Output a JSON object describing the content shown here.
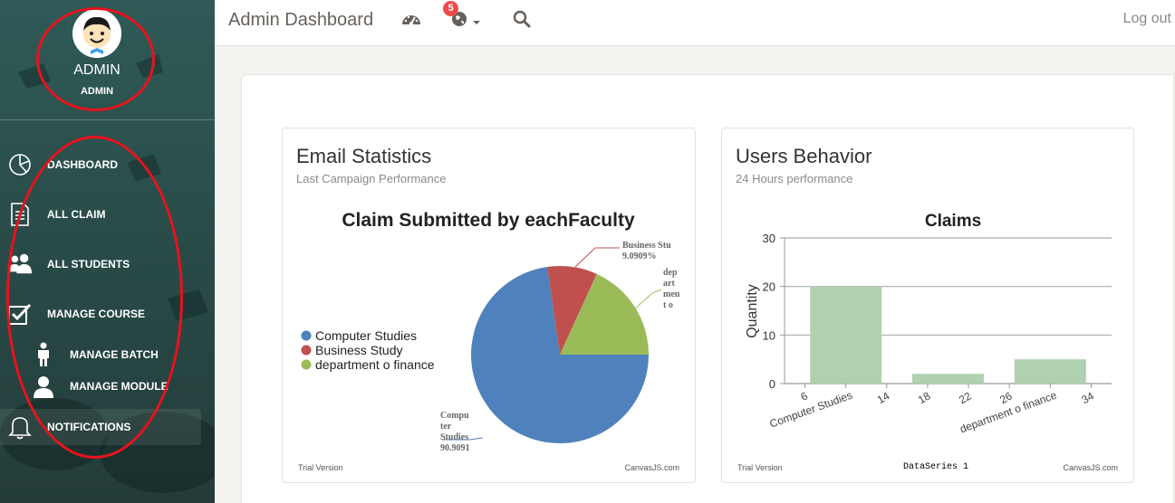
{
  "sidebar": {
    "admin_name": "ADMIN",
    "admin_role": "ADMIN",
    "items": [
      {
        "label": "DASHBOARD",
        "icon": "pie-chart-icon"
      },
      {
        "label": "ALL CLAIM",
        "icon": "document-icon"
      },
      {
        "label": "ALL STUDENTS",
        "icon": "users-icon"
      },
      {
        "label": "MANAGE COURSE",
        "icon": "checkbox-icon"
      },
      {
        "label": "MANAGE BATCH",
        "icon": "person-icon"
      },
      {
        "label": "MANAGE MODULE",
        "icon": "user-icon"
      },
      {
        "label": "NOTIFICATIONS",
        "icon": "bell-icon"
      }
    ]
  },
  "topbar": {
    "title": "Admin Dashboard",
    "notification_count": "5",
    "logout_label": "Log out",
    "icons": [
      "dashboard-icon",
      "globe-icon",
      "chevron-down-icon",
      "search-icon"
    ]
  },
  "email_panel": {
    "title": "Email Statistics",
    "subtitle": "Last Campaign Performance",
    "trial": "Trial Version",
    "credit": "CanvasJS.com"
  },
  "users_panel": {
    "title": "Users Behavior",
    "subtitle": "24 Hours performance",
    "trial": "Trial Version",
    "credit": "CanvasJS.com",
    "series_label": "DataSeries 1"
  },
  "colors": {
    "accent_blue": "#4f81bc",
    "accent_red": "#c0504e",
    "accent_green": "#9bbb58",
    "bar_green": "#b0d1b0",
    "annotation_red": "#e8121c"
  },
  "chart_data": [
    {
      "type": "pie",
      "title": "Claim Submitted by eachFaculty",
      "labels": [
        "Computer Studies",
        "Business Study",
        "department o finance"
      ],
      "values": [
        72.7273,
        9.0909,
        18.1818
      ],
      "colors": [
        "#4f81bc",
        "#c0504e",
        "#9bbb58"
      ],
      "index_labels": [
        "Compu\nter\nStudies\n90.9091",
        "Business Stu\n9.0909%",
        "dep\nart\nmen\nt o"
      ],
      "legend": "left"
    },
    {
      "type": "bar",
      "title": "Claims",
      "ylabel": "Quantity",
      "xlabel": "",
      "ylim": [
        0,
        30
      ],
      "yticks": [
        0,
        10,
        20,
        30
      ],
      "xlim": [
        4,
        36
      ],
      "xticks": [
        6,
        14,
        18,
        22,
        26,
        34
      ],
      "bars": [
        {
          "x": 10,
          "label": "Computer Studies",
          "value": 20
        },
        {
          "x": 20,
          "label": "",
          "value": 2
        },
        {
          "x": 30,
          "label": "department o finance",
          "value": 5
        }
      ]
    }
  ]
}
